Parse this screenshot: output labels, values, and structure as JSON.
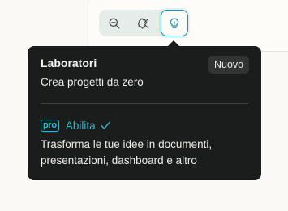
{
  "toolbar": {
    "icons": [
      "zoom-search-icon",
      "puzzle-icon",
      "lightbulb-icon"
    ],
    "active_icon": "lightbulb-icon"
  },
  "tooltip": {
    "title": "Laboratori",
    "badge": "Nuovo",
    "subtitle": "Crea progetti da zero",
    "pro_badge": "pro",
    "enable_label": "Abilita",
    "description": "Trasforma le tue idee in documenti, presentazioni, dashboard e altro"
  },
  "colors": {
    "accent": "#37b4c8",
    "tooltip_bg": "#1b1c1c",
    "page_bg": "#faf9f5",
    "active_border": "#2a8ea0"
  }
}
